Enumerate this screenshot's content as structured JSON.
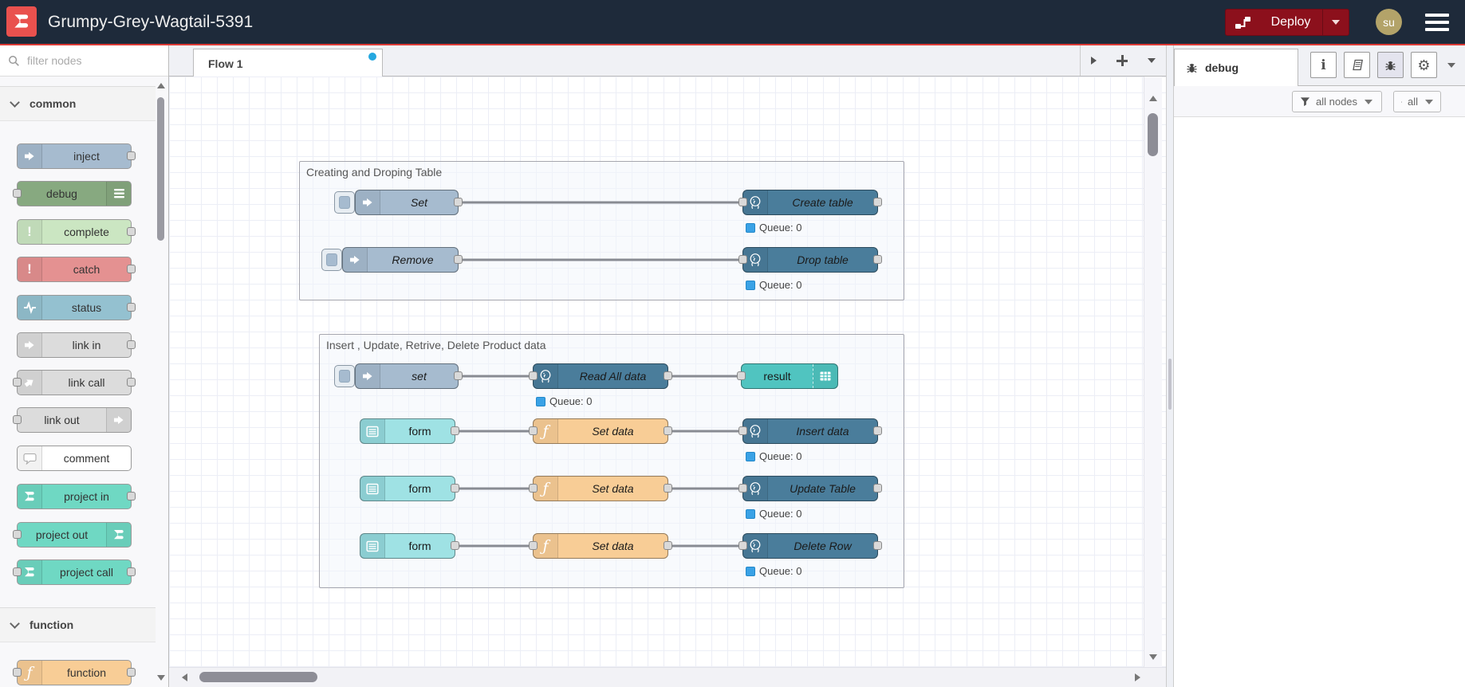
{
  "header": {
    "title": "Grumpy-Grey-Wagtail-5391",
    "deploy_label": "Deploy",
    "avatar": "su"
  },
  "palette": {
    "search_placeholder": "filter nodes",
    "categories": [
      {
        "label": "common"
      },
      {
        "label": "function"
      }
    ],
    "nodes": [
      {
        "label": "inject"
      },
      {
        "label": "debug"
      },
      {
        "label": "complete"
      },
      {
        "label": "catch"
      },
      {
        "label": "status"
      },
      {
        "label": "link in"
      },
      {
        "label": "link call"
      },
      {
        "label": "link out"
      },
      {
        "label": "comment"
      },
      {
        "label": "project in"
      },
      {
        "label": "project out"
      },
      {
        "label": "project call"
      },
      {
        "label": "function"
      }
    ]
  },
  "workspace": {
    "tab_label": "Flow 1",
    "queue_label": "Queue: 0",
    "groups": [
      {
        "label": "Creating and Droping Table"
      },
      {
        "label": "Insert , Update, Retrive, Delete Product data"
      }
    ],
    "nodes": {
      "set1": "Set",
      "create_table": "Create table",
      "remove": "Remove",
      "drop_table": "Drop table",
      "set2": "set",
      "read_all": "Read All data",
      "result": "result",
      "form1": "form",
      "form2": "form",
      "form3": "form",
      "setdata1": "Set data",
      "setdata2": "Set data",
      "setdata3": "Set data",
      "insert_data": "Insert data",
      "update_table": "Update Table",
      "delete_row": "Delete Row"
    }
  },
  "sidebar": {
    "tab_label": "debug",
    "filter_button": "all nodes",
    "clear_button": "all"
  },
  "icons": {
    "alert": "!",
    "function_glyph": "ƒ",
    "info_glyph": "i",
    "gear_glyph": "⚙"
  },
  "colors": {
    "header_bg": "#1e2a3a",
    "accent_red": "#dd3b36",
    "logo_red": "#e9514e",
    "deploy_red": "#8C101C",
    "avatar_olive": "#b3a369",
    "node_inject": "#a6bbcf",
    "node_debug": "#87a980",
    "node_complete": "#cbe6c2",
    "node_catch": "#e49191",
    "node_status": "#94c1d0",
    "node_link": "#dcdcdc",
    "node_comment": "#ffffff",
    "node_project": "#6fd8c3",
    "node_function": "#f8cd96",
    "node_postgres": "#4a7d9b",
    "node_form": "#9fe2e4",
    "node_result": "#50c4c0",
    "status_dot_blue": "#3aa2e6",
    "tab_dot_blue": "#25a8e0",
    "wire_grey": "#888b92"
  }
}
